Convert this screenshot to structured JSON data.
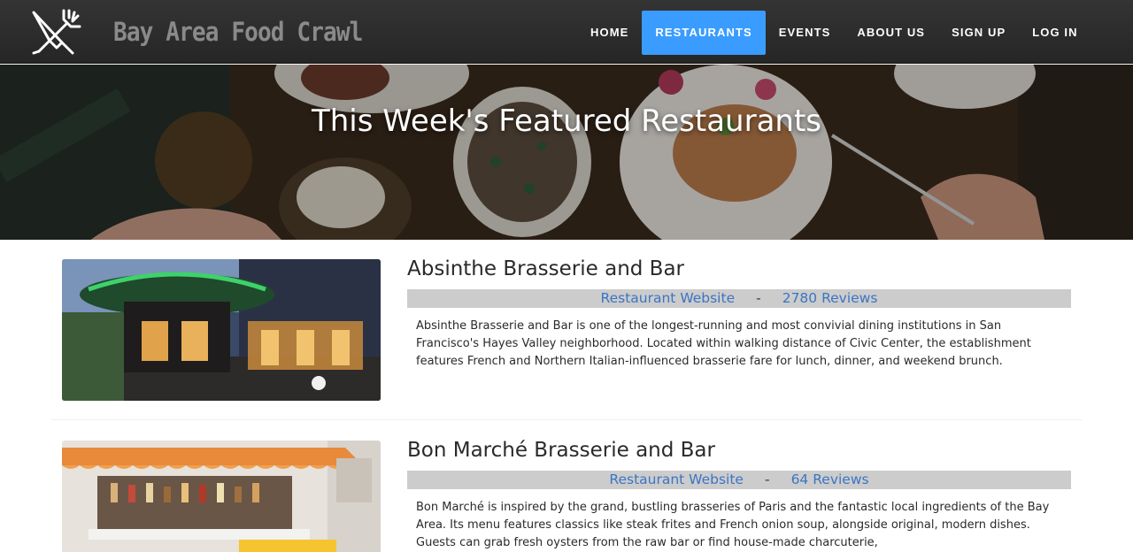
{
  "brand": {
    "title": "Bay Area Food Crawl",
    "logo_icon": "fork-knife-crossed-icon"
  },
  "nav": {
    "items": [
      {
        "label": "HOME"
      },
      {
        "label": "RESTAURANTS"
      },
      {
        "label": "EVENTS"
      },
      {
        "label": "ABOUT US"
      },
      {
        "label": "SIGN UP"
      },
      {
        "label": "LOG IN"
      }
    ],
    "active": "RESTAURANTS"
  },
  "hero": {
    "title": "This Week's Featured Restaurants"
  },
  "restaurants": [
    {
      "name": "Absinthe Brasserie and Bar",
      "website_label": "Restaurant Website",
      "separator": "-",
      "reviews_label": "2780 Reviews",
      "description": "Absinthe Brasserie and Bar is one of the longest-running and most convivial dining institutions in San Francisco's Hayes Valley neighborhood. Located within walking distance of Civic Center, the establishment features French and Northern Italian-influenced brasserie fare for lunch, dinner, and weekend brunch."
    },
    {
      "name": "Bon Marché Brasserie and Bar",
      "website_label": "Restaurant Website",
      "separator": "-",
      "reviews_label": "64 Reviews",
      "description": "Bon Marché is inspired by the grand, bustling brasseries of Paris and the fantastic local ingredients of the Bay Area. Its menu features classics like steak frites and French onion soup, alongside original, modern dishes. Guests can grab fresh oysters from the raw bar or find house-made charcuterie,"
    }
  ],
  "colors": {
    "navbar_bg": "#2e2e2e",
    "nav_active": "#3a9cff",
    "link": "#3b75c4",
    "links_bar": "#cccccc"
  }
}
